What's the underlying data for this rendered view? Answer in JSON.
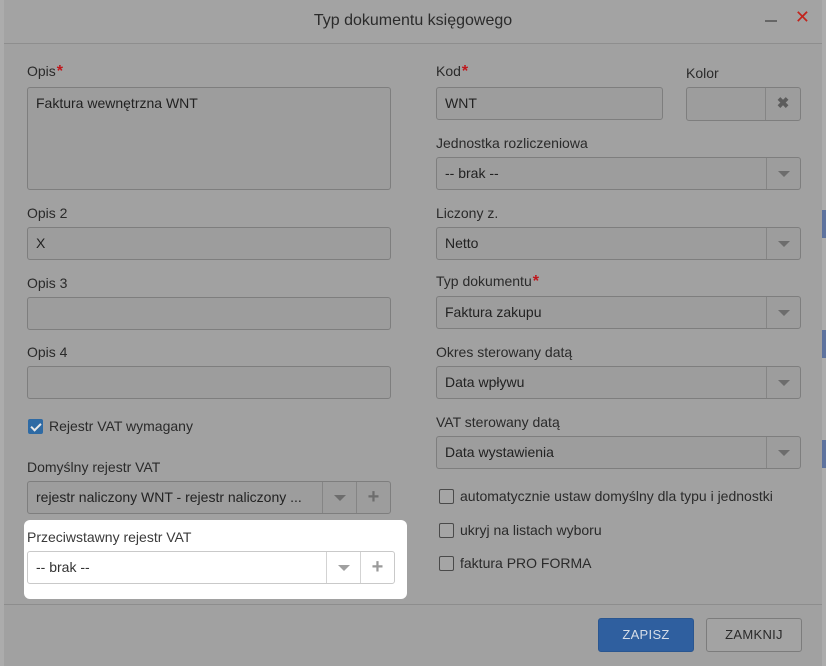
{
  "dialog": {
    "title": "Typ dokumentu księgowego",
    "close_glyph": "✕",
    "minimize_icon": "minimize-icon",
    "close_icon": "close-icon"
  },
  "left": {
    "opis": {
      "label": "Opis",
      "required": "*",
      "value": "Faktura wewnętrzna WNT"
    },
    "opis2": {
      "label": "Opis 2",
      "value": "X"
    },
    "opis3": {
      "label": "Opis 3",
      "value": ""
    },
    "opis4": {
      "label": "Opis 4",
      "value": ""
    },
    "rejestr_vat_wymagany": {
      "label": "Rejestr VAT wymagany",
      "checked": true
    },
    "domyslny_rejestr": {
      "label": "Domyślny rejestr VAT",
      "value": "rejestr naliczony WNT - rejestr naliczony ..."
    },
    "przeciwstawny_rejestr": {
      "label": "Przeciwstawny rejestr VAT",
      "value": "-- brak --"
    }
  },
  "right": {
    "kod": {
      "label": "Kod",
      "required": "*",
      "value": "WNT"
    },
    "kolor": {
      "label": "Kolor",
      "value": "",
      "clear_glyph": "✖"
    },
    "jednostka": {
      "label": "Jednostka rozliczeniowa",
      "value": "-- brak --"
    },
    "liczony": {
      "label": "Liczony z.",
      "value": "Netto"
    },
    "typ_dokumentu": {
      "label": "Typ dokumentu",
      "required": "*",
      "value": "Faktura zakupu"
    },
    "okres": {
      "label": "Okres sterowany datą",
      "value": "Data wpływu"
    },
    "vat_sterowany": {
      "label": "VAT sterowany datą",
      "value": "Data wystawienia"
    },
    "checkboxes": [
      {
        "label": "automatycznie ustaw domyślny dla typu i jednostki",
        "checked": false
      },
      {
        "label": "ukryj na listach wyboru",
        "checked": false
      },
      {
        "label": "faktura PRO FORMA",
        "checked": false
      }
    ]
  },
  "footer": {
    "save_label": "ZAPISZ",
    "close_label": "ZAMKNIJ"
  },
  "glyphs": {
    "plus": "+"
  },
  "colors": {
    "primary": "#2f5f9f",
    "required": "#c0161b",
    "close": "#c2241c",
    "checkbox_on": "#2e6aa4"
  }
}
